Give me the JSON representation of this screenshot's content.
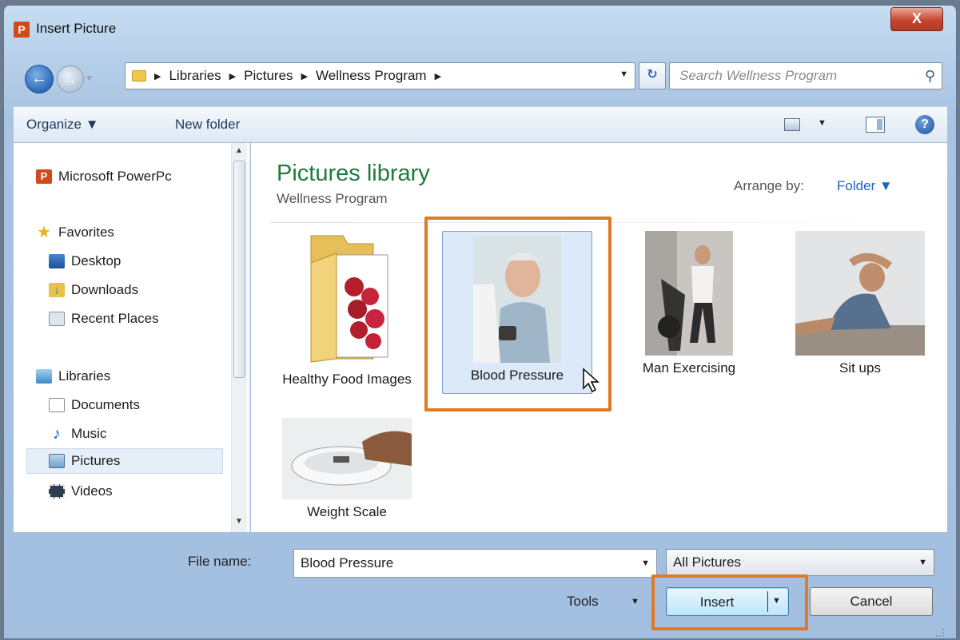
{
  "window": {
    "title": "Insert Picture",
    "app_icon": "P",
    "close_label": "X"
  },
  "address": {
    "breadcrumbs": [
      "Libraries",
      "Pictures",
      "Wellness Program"
    ],
    "search_placeholder": "Search Wellness Program"
  },
  "toolbar": {
    "organize_label": "Organize ▼",
    "new_folder_label": "New folder"
  },
  "nav_pane": {
    "items": [
      {
        "label": "Microsoft PowerPc",
        "icon": "powerpoint-icon"
      },
      {
        "label": "Favorites",
        "icon": "star-icon"
      },
      {
        "label": "Desktop",
        "icon": "desktop-icon"
      },
      {
        "label": "Downloads",
        "icon": "downloads-icon"
      },
      {
        "label": "Recent Places",
        "icon": "recent-places-icon"
      },
      {
        "label": "Libraries",
        "icon": "libraries-icon"
      },
      {
        "label": "Documents",
        "icon": "documents-icon"
      },
      {
        "label": "Music",
        "icon": "music-icon"
      },
      {
        "label": "Pictures",
        "icon": "pictures-icon",
        "selected": true
      },
      {
        "label": "Videos",
        "icon": "videos-icon"
      }
    ]
  },
  "content": {
    "title": "Pictures library",
    "subtitle": "Wellness Program",
    "arrange_label": "Arrange by:",
    "arrange_value": "Folder ▼",
    "tiles": [
      {
        "label": "Healthy Food Images",
        "type": "folder"
      },
      {
        "label": "Blood Pressure",
        "type": "image",
        "selected": true
      },
      {
        "label": "Man Exercising",
        "type": "image"
      },
      {
        "label": "Sit ups",
        "type": "image"
      },
      {
        "label": "Weight Scale",
        "type": "image"
      }
    ]
  },
  "footer": {
    "filename_label": "File name:",
    "filename_value": "Blood Pressure",
    "filter_value": "All Pictures",
    "tools_label": "Tools",
    "insert_label": "Insert",
    "cancel_label": "Cancel"
  },
  "colors": {
    "highlight": "#e07a25",
    "library_title": "#1f7a3c",
    "link": "#1d62c4"
  }
}
